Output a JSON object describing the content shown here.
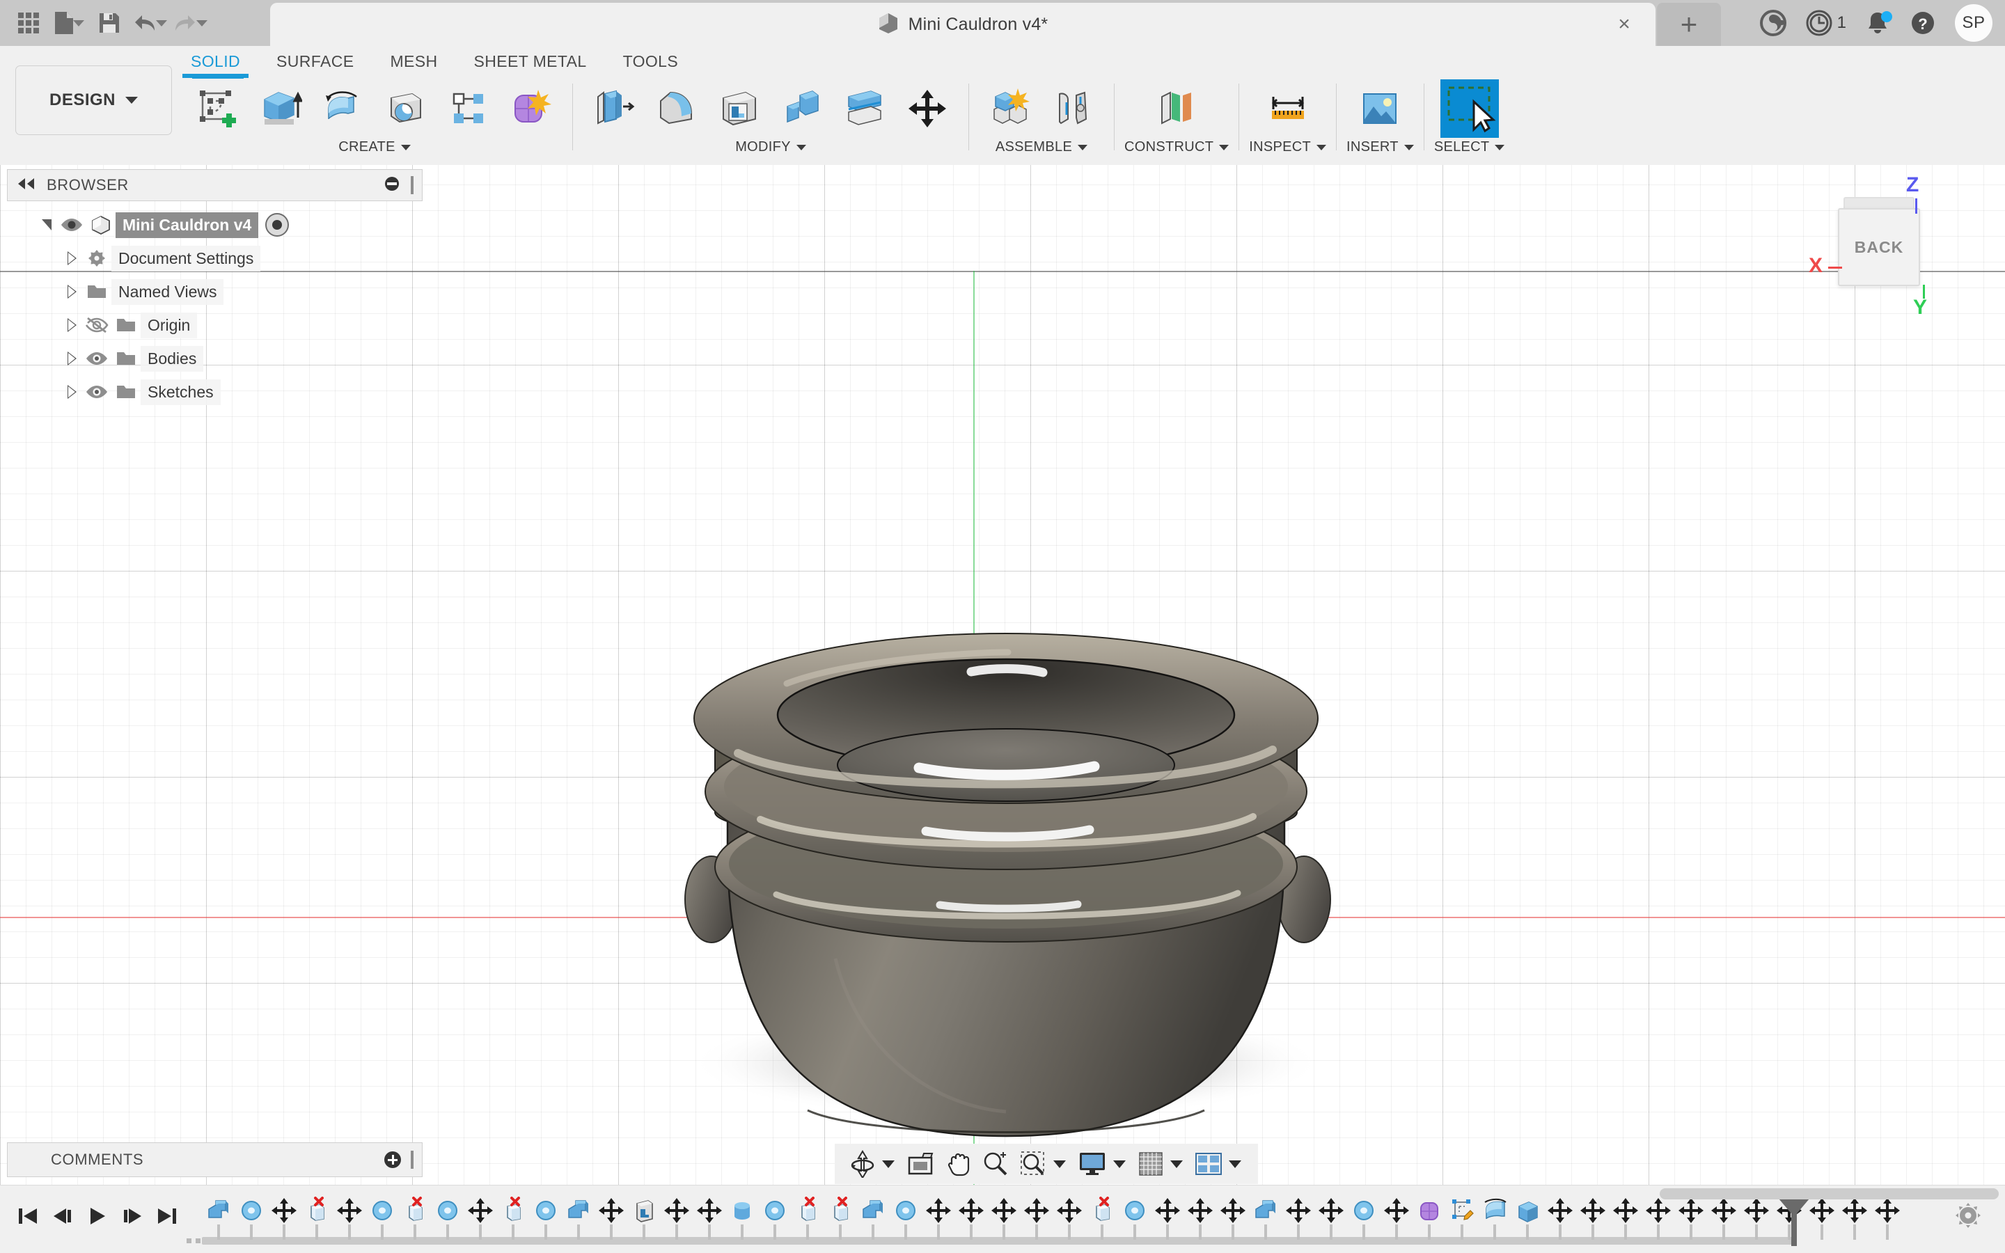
{
  "app": {
    "name": "Autodesk Fusion 360",
    "accent_color": "#1a9ad7",
    "titlebar_bg": "#c8c8c8",
    "ribbon_bg": "#f0f0f0"
  },
  "titlebar": {
    "quick_access": [
      {
        "name": "app-grid-icon",
        "label": "Show Data Panel"
      },
      {
        "name": "new-file-icon",
        "label": "File"
      },
      {
        "name": "save-icon",
        "label": "Save"
      },
      {
        "name": "undo-icon",
        "label": "Undo"
      },
      {
        "name": "redo-icon",
        "label": "Redo"
      }
    ],
    "document_tab": {
      "title": "Mini Cauldron v4*",
      "close_label": "×"
    },
    "new_tab_label": "+",
    "right_icons": [
      {
        "name": "extensions-icon",
        "label": "Extensions"
      },
      {
        "name": "job-status-icon",
        "label": "Job Status",
        "count": "1"
      },
      {
        "name": "notifications-icon",
        "label": "Notifications"
      },
      {
        "name": "help-icon",
        "label": "Help"
      }
    ],
    "avatar_initials": "SP"
  },
  "ribbon": {
    "workspace": "DESIGN",
    "tabs": [
      {
        "label": "SOLID",
        "active": true
      },
      {
        "label": "SURFACE",
        "active": false
      },
      {
        "label": "MESH",
        "active": false
      },
      {
        "label": "SHEET METAL",
        "active": false
      },
      {
        "label": "TOOLS",
        "active": false
      }
    ],
    "panels": [
      {
        "label": "CREATE",
        "tools": [
          {
            "name": "create-sketch-icon",
            "label": "Create Sketch"
          },
          {
            "name": "extrude-icon",
            "label": "Extrude"
          },
          {
            "name": "revolve-icon",
            "label": "Revolve"
          },
          {
            "name": "sweep-icon",
            "label": "Sweep"
          },
          {
            "name": "pattern-icon",
            "label": "Rectangular Pattern"
          },
          {
            "name": "create-form-icon",
            "label": "Create Form"
          }
        ]
      },
      {
        "label": "MODIFY",
        "tools": [
          {
            "name": "press-pull-icon",
            "label": "Press Pull"
          },
          {
            "name": "fillet-icon",
            "label": "Fillet"
          },
          {
            "name": "shell-icon",
            "label": "Shell"
          },
          {
            "name": "combine-icon",
            "label": "Combine"
          },
          {
            "name": "split-body-icon",
            "label": "Split Body"
          },
          {
            "name": "move-copy-icon",
            "label": "Move/Copy"
          }
        ]
      },
      {
        "label": "ASSEMBLE",
        "tools": [
          {
            "name": "new-component-icon",
            "label": "New Component"
          },
          {
            "name": "joint-icon",
            "label": "Joint"
          }
        ]
      },
      {
        "label": "CONSTRUCT",
        "tools": [
          {
            "name": "offset-plane-icon",
            "label": "Offset Plane"
          }
        ]
      },
      {
        "label": "INSPECT",
        "tools": [
          {
            "name": "measure-icon",
            "label": "Measure"
          }
        ]
      },
      {
        "label": "INSERT",
        "tools": [
          {
            "name": "insert-image-icon",
            "label": "Decal"
          }
        ]
      },
      {
        "label": "SELECT",
        "tools": [
          {
            "name": "select-icon",
            "label": "Select",
            "active": true
          }
        ]
      }
    ]
  },
  "browser": {
    "title": "BROWSER",
    "collapse_icon": "collapse-left-icon",
    "minimize_icon": "minimize-icon",
    "tree": [
      {
        "label": "Mini Cauldron v4",
        "icon": "component-icon",
        "expanded": true,
        "visible": true,
        "selected": true,
        "has_radio": true,
        "indent": 0
      },
      {
        "label": "Document Settings",
        "icon": "gear-icon",
        "expanded": false,
        "visible": null,
        "selected": false,
        "has_radio": false,
        "indent": 1
      },
      {
        "label": "Named Views",
        "icon": "folder-icon",
        "expanded": false,
        "visible": null,
        "selected": false,
        "has_radio": false,
        "indent": 1
      },
      {
        "label": "Origin",
        "icon": "folder-icon",
        "expanded": false,
        "visible": false,
        "selected": false,
        "has_radio": false,
        "indent": 1
      },
      {
        "label": "Bodies",
        "icon": "folder-icon",
        "expanded": false,
        "visible": true,
        "selected": false,
        "has_radio": false,
        "indent": 1
      },
      {
        "label": "Sketches",
        "icon": "folder-icon",
        "expanded": false,
        "visible": true,
        "selected": false,
        "has_radio": false,
        "indent": 1
      }
    ]
  },
  "canvas": {
    "view_cube": {
      "face_label": "BACK",
      "axis_labels": {
        "x": "X",
        "y": "Y",
        "z": "Z"
      },
      "axis_colors": {
        "x": "#ef4a4a",
        "y": "#2fce56",
        "z": "#5a5aef"
      }
    },
    "model": {
      "name": "mini-cauldron-body",
      "material_color": "#6f6a63",
      "highlight_color": "#c9c2b4"
    },
    "grid_color": "#e2e2e2"
  },
  "comments": {
    "title": "COMMENTS",
    "add_icon": "add-comment-icon"
  },
  "navbar": {
    "items": [
      {
        "name": "orbit-icon",
        "label": "Orbit",
        "has_caret": true
      },
      {
        "name": "look-at-icon",
        "label": "Look At",
        "has_caret": false
      },
      {
        "name": "pan-icon",
        "label": "Pan",
        "has_caret": false
      },
      {
        "name": "zoom-icon",
        "label": "Zoom",
        "has_caret": false
      },
      {
        "name": "zoom-window-icon",
        "label": "Fit",
        "has_caret": true
      },
      {
        "name": "display-settings-icon",
        "label": "Display Settings",
        "has_caret": true
      },
      {
        "name": "grid-snaps-icon",
        "label": "Grid and Snaps",
        "has_caret": true
      },
      {
        "name": "viewports-icon",
        "label": "Viewports",
        "has_caret": true
      }
    ]
  },
  "timeline": {
    "playback": [
      {
        "name": "go-to-beginning-icon",
        "label": "Go to beginning"
      },
      {
        "name": "step-back-icon",
        "label": "Step back"
      },
      {
        "name": "play-icon",
        "label": "Play"
      },
      {
        "name": "step-forward-icon",
        "label": "Step forward"
      },
      {
        "name": "go-to-end-icon",
        "label": "Go to end"
      }
    ],
    "settings_icon": "timeline-settings-icon",
    "marker_position_index": 48,
    "features": [
      "extrude",
      "fillet",
      "move",
      "delete-face",
      "move",
      "fillet",
      "delete-face",
      "fillet",
      "move",
      "delete-face",
      "fillet",
      "extrude",
      "move",
      "shell",
      "move",
      "move",
      "revolve",
      "fillet",
      "delete-face",
      "delete-face",
      "extrude",
      "fillet",
      "move",
      "move",
      "move",
      "move",
      "move",
      "delete-face",
      "fillet",
      "move",
      "move",
      "move",
      "extrude",
      "move",
      "move",
      "fillet",
      "move",
      "form",
      "sketch",
      "sweep",
      "box",
      "move",
      "move",
      "align",
      "move",
      "move",
      "move",
      "move",
      "move",
      "move",
      "move",
      "move"
    ]
  }
}
